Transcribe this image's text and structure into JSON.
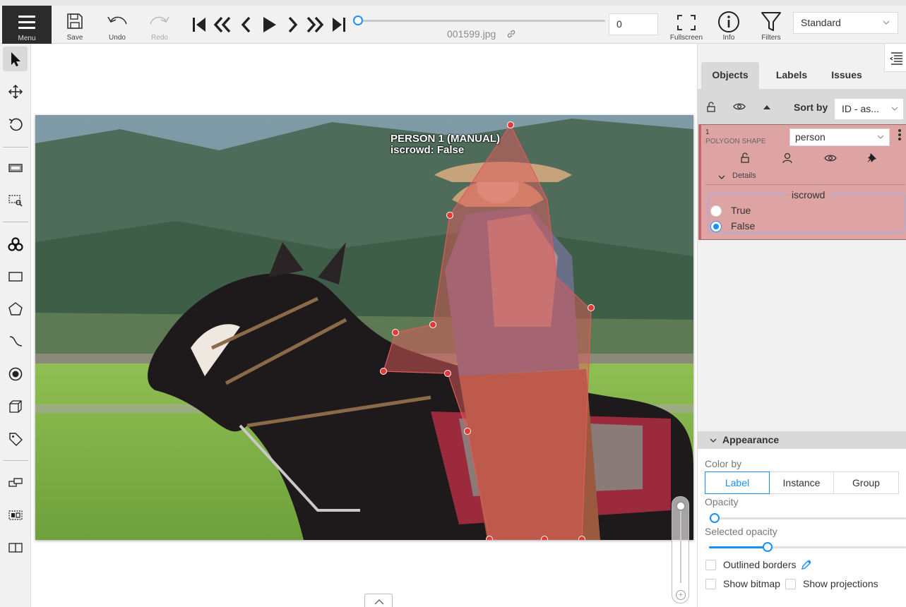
{
  "header": {
    "menu_label": "Menu",
    "save_label": "Save",
    "undo_label": "Undo",
    "redo_label": "Redo",
    "frame_filename": "001599.jpg",
    "frame_number": "0",
    "fullscreen_label": "Fullscreen",
    "info_label": "Info",
    "filters_label": "Filters",
    "workspace": "Standard",
    "player_buttons": [
      "first-frame",
      "previous-step",
      "previous-frame",
      "play",
      "next-frame",
      "next-step",
      "last-frame"
    ]
  },
  "left_toolbar": {
    "tools": [
      "cursor",
      "move",
      "rotate",
      "fit-image",
      "select-region",
      "opencv",
      "rectangle",
      "polygon",
      "polyline",
      "points",
      "cuboid",
      "tag",
      "merge",
      "group",
      "split"
    ],
    "active_tool": "cursor"
  },
  "canvas": {
    "shape_label_line1": "PERSON 1 (MANUAL)",
    "shape_label_line2": "iscrowd: False",
    "shape_color": "#e05a5a"
  },
  "sidebar": {
    "tabs": [
      "Objects",
      "Labels",
      "Issues"
    ],
    "active_tab": "Objects",
    "sort_by_label": "Sort by",
    "sort_by_value": "ID - as...",
    "object": {
      "id": "1",
      "type": "POLYGON SHAPE",
      "label": "person",
      "details_label": "Details",
      "attribute_name": "iscrowd",
      "options": [
        "True",
        "False"
      ],
      "selected_option": "False",
      "card_color": "#dea4a4"
    },
    "appearance": {
      "title": "Appearance",
      "color_by_label": "Color by",
      "color_by_options": [
        "Label",
        "Instance",
        "Group"
      ],
      "color_by_selected": "Label",
      "opacity_label": "Opacity",
      "opacity_value": 0,
      "selected_opacity_label": "Selected opacity",
      "selected_opacity_value": 0.3,
      "outlined_borders_label": "Outlined borders",
      "show_bitmap_label": "Show bitmap",
      "show_projections_label": "Show projections"
    }
  },
  "colors": {
    "accent": "#1890ff",
    "menu_bg": "#2b2b2b",
    "panel_bg": "#f1f1f1"
  }
}
